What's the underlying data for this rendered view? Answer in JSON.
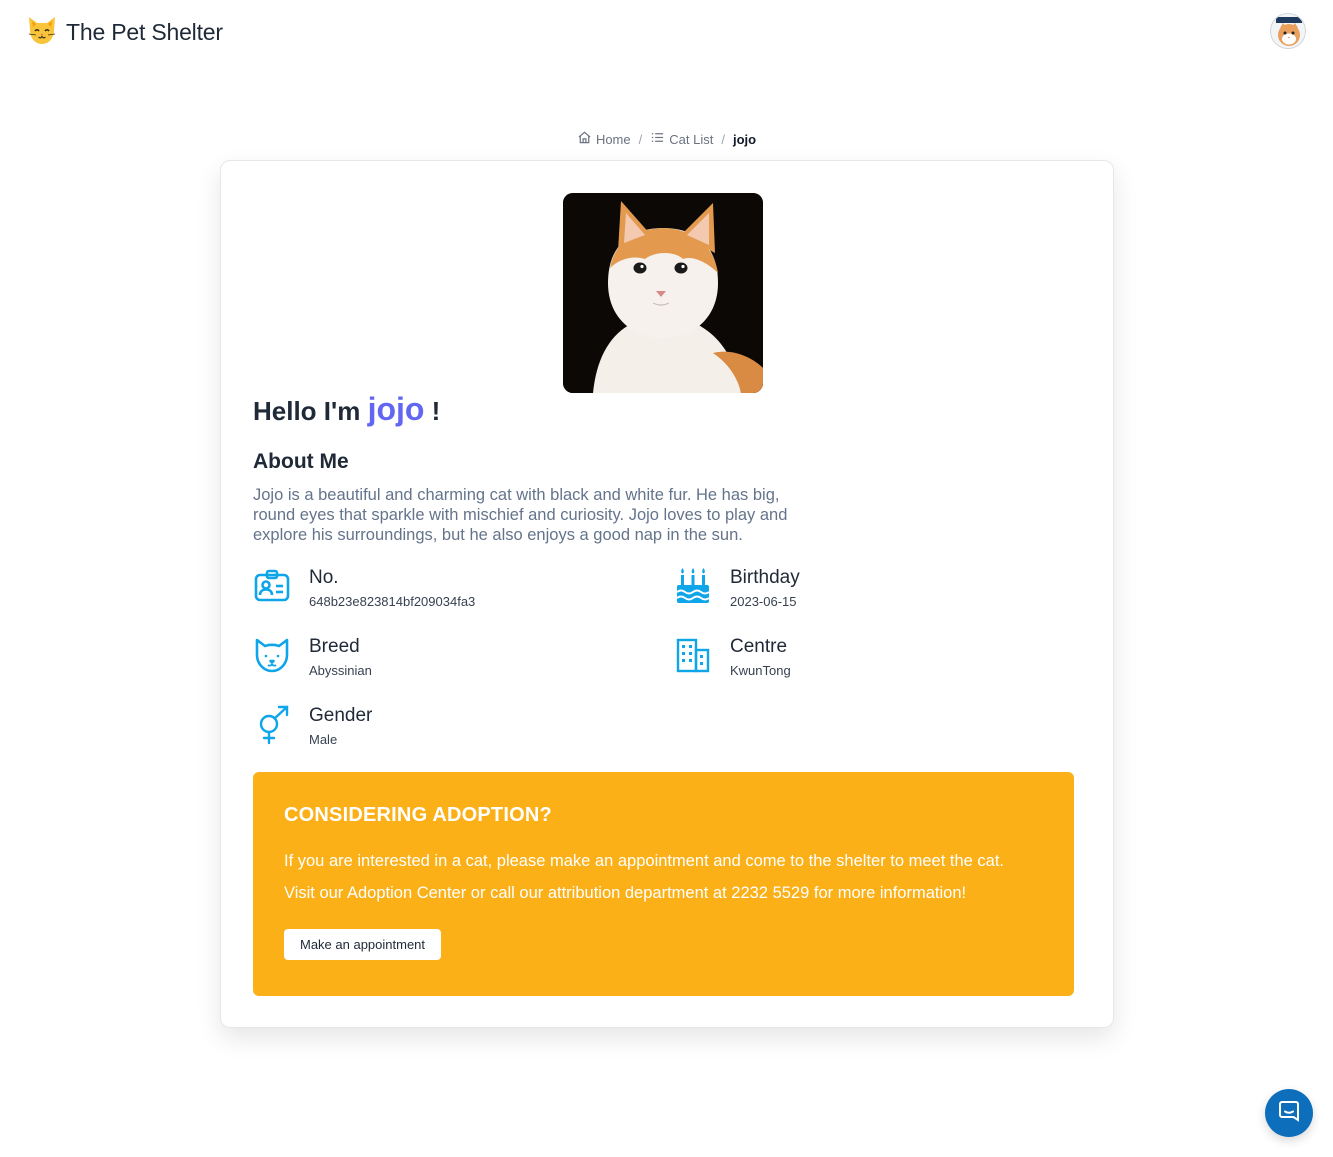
{
  "header": {
    "logo_icon": "cat-face-emoji",
    "brand_name": "The Pet Shelter",
    "avatar_icon": "user-avatar"
  },
  "breadcrumb": {
    "home_label": "Home",
    "list_label": "Cat List",
    "current_label": "jojo",
    "separator": "/"
  },
  "profile": {
    "photo_icon": "cat-photo",
    "greeting_prefix": "Hello I'm",
    "name": "jojo",
    "greeting_suffix": "!",
    "about_title": "About Me",
    "about_text": "Jojo is a beautiful and charming cat with black and white fur. He has big, round eyes that sparkle with mischief and curiosity. Jojo loves to play and explore his surroundings, but he also enjoys a good nap in the sun."
  },
  "details": {
    "no": {
      "label": "No.",
      "value": "648b23e823814bf209034fa3",
      "icon": "id-card-icon"
    },
    "birthday": {
      "label": "Birthday",
      "value": "2023-06-15",
      "icon": "cake-icon"
    },
    "breed": {
      "label": "Breed",
      "value": "Abyssinian",
      "icon": "cat-face-icon"
    },
    "centre": {
      "label": "Centre",
      "value": "KwunTong",
      "icon": "building-icon"
    },
    "gender": {
      "label": "Gender",
      "value": "Male",
      "icon": "gender-icon"
    }
  },
  "adoption": {
    "title": "CONSIDERING ADOPTION?",
    "line1": "If you are interested in a cat, please make an appointment and come to the shelter to meet the cat.",
    "line2": "Visit our Adoption Center or call our attribution department at 2232 5529 for more information!",
    "button_label": "Make an appointment"
  },
  "chat": {
    "icon": "chat-icon"
  },
  "colors": {
    "accent": "#6366f1",
    "icon_blue": "#0ea5e9",
    "cta_bg": "#fbb017",
    "chat_bg": "#0d6ebb"
  }
}
